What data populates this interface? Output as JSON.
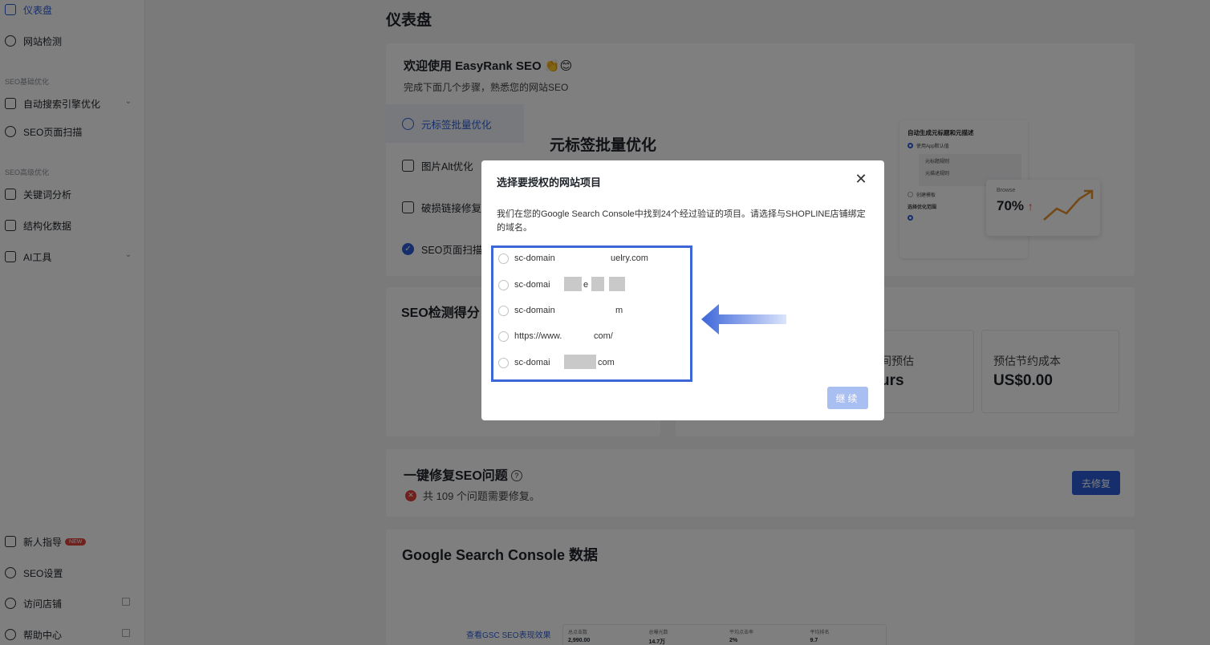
{
  "sidebar": {
    "items": [
      {
        "label": "仪表盘",
        "icon": "chart-icon"
      },
      {
        "label": "网站检测",
        "icon": "target-icon"
      },
      {
        "label": "自动搜索引擎优化",
        "icon": "monitor-icon"
      },
      {
        "label": "SEO页面扫描",
        "icon": "scan-icon"
      },
      {
        "label": "关键词分析",
        "icon": "keyword-icon"
      },
      {
        "label": "结构化数据",
        "icon": "structure-icon"
      },
      {
        "label": "AI工具",
        "icon": "ai-icon"
      },
      {
        "label": "新人指导",
        "icon": "book-icon"
      },
      {
        "label": "SEO设置",
        "icon": "settings-icon"
      },
      {
        "label": "访问店铺",
        "icon": "eye-icon"
      },
      {
        "label": "帮助中心",
        "icon": "help-icon"
      }
    ],
    "sections": {
      "basic": "SEO基础优化",
      "advanced": "SEO高级优化"
    },
    "new_badge": "NEW"
  },
  "main": {
    "page_title": "仪表盘",
    "welcome": {
      "title": "欢迎使用 EasyRank SEO 👏😊",
      "subtitle": "完成下面几个步骤，熟悉您的网站SEO"
    },
    "steps": [
      {
        "label": "元标签批量优化"
      },
      {
        "label": "图片Alt优化"
      },
      {
        "label": "破损链接修复"
      },
      {
        "label": "SEO页面扫描"
      }
    ],
    "feature_heading": "元标签批量优化",
    "preview": {
      "title": "自动生成元标题和元描述",
      "opt1": "使用App默认值",
      "field1": "元标题规则",
      "field2": "元描述规则",
      "opt2": "创建模板",
      "scope": "选择优化范围",
      "browse_label": "Browse",
      "browse_value": "70%"
    },
    "score_title": "SEO检测得分",
    "stats": [
      {
        "label": "间预估",
        "value": "urs"
      },
      {
        "label": "预估节约成本",
        "value": "US$0.00"
      }
    ],
    "fix": {
      "title": "一键修复SEO问题",
      "subtitle": "共 109 个问题需要修复。",
      "button": "去修复"
    },
    "gsc": {
      "title": "Google Search Console 数据",
      "link": "查看GSC SEO表现效果",
      "metrics": [
        {
          "label": "总点击数",
          "value": "2,990.00"
        },
        {
          "label": "总曝光数",
          "value": "14.7万"
        },
        {
          "label": "平均点击率",
          "value": "2%"
        },
        {
          "label": "平均排名",
          "value": "9.7"
        }
      ]
    }
  },
  "modal": {
    "title": "选择要授权的网站项目",
    "description": "我们在您的Google Search Console中找到24个经过验证的项目。请选择与SHOPLINE店铺绑定的域名。",
    "options": [
      {
        "label": "sc-domain",
        "suffix": "uelry.com"
      },
      {
        "label": "sc-domai",
        "suffix": "e"
      },
      {
        "label": "sc-domain",
        "suffix": "m"
      },
      {
        "label": "https://www.",
        "suffix": "com/"
      },
      {
        "label": "sc-domai",
        "suffix": "com"
      }
    ],
    "continue_button": "继续"
  }
}
